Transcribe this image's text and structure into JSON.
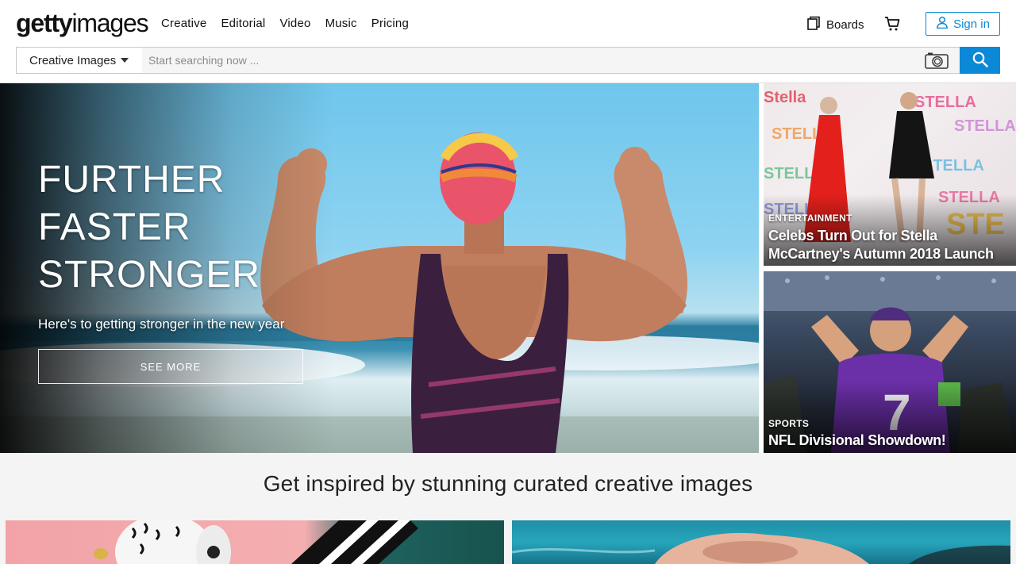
{
  "brand": {
    "logo_bold": "getty",
    "logo_light": "images"
  },
  "nav": {
    "links": [
      "Creative",
      "Editorial",
      "Video",
      "Music",
      "Pricing"
    ],
    "boards_label": "Boards",
    "signin_label": "Sign in"
  },
  "search": {
    "category_label": "Creative Images",
    "placeholder": "Start searching now ...",
    "value": ""
  },
  "hero": {
    "title_lines": [
      "FURTHER",
      "FASTER",
      "STRONGER"
    ],
    "subtitle": "Here's to getting stronger in the new year",
    "cta_label": "SEE MORE"
  },
  "side_cards": [
    {
      "category": "ENTERTAINMENT",
      "headline": "Celebs Turn Out for Stella McCartney's Autumn 2018 Launch"
    },
    {
      "category": "SPORTS",
      "headline": "NFL Divisional Showdown!"
    }
  ],
  "curated": {
    "heading": "Get inspired by stunning curated creative images"
  },
  "colors": {
    "accent": "#0c89d6",
    "section_bg": "#f4f4f4"
  },
  "icons": [
    "boards-icon",
    "cart-icon",
    "user-icon",
    "camera-icon",
    "search-icon",
    "caret-down-icon"
  ]
}
